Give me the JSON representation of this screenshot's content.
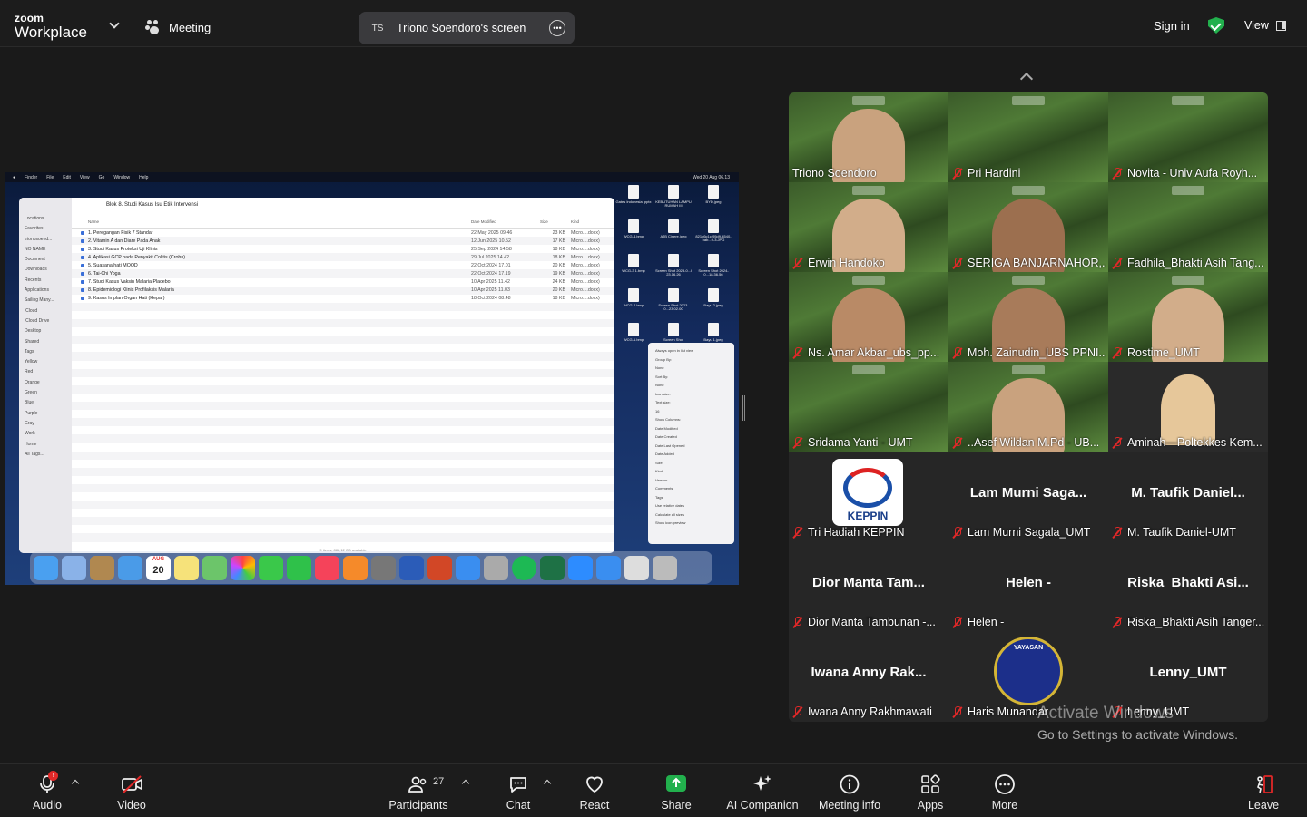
{
  "app": {
    "logo_line1": "zoom",
    "logo_line2": "Workplace",
    "meeting_label": "Meeting",
    "screen_share": {
      "initials": "TS",
      "label": "Triono Soendoro's screen"
    },
    "sign_in": "Sign in",
    "view": "View",
    "accent": "#22b04d"
  },
  "shared_screen": {
    "menubar": [
      "Finder",
      "File",
      "Edit",
      "View",
      "Go",
      "Window",
      "Help"
    ],
    "clock": "Wed 20 Aug 06.13",
    "finder_title": "Blok 8. Studi Kasus Isu Etik Intervensi",
    "sidebar": [
      "Locations",
      "Favorites",
      "trionosoend...",
      "NO NAME",
      "Document",
      "Downloads",
      "Recents",
      "Applications",
      "Sailing Many...",
      "iCloud",
      "iCloud Drive",
      "Desktop",
      "Shared",
      "Tags",
      "Yellow",
      "Red",
      "Orange",
      "Green",
      "Blue",
      "Purple",
      "Gray",
      "Work",
      "Home",
      "All Tags..."
    ],
    "columns": [
      "Name",
      "Date Modified",
      "Size",
      "Kind"
    ],
    "files": [
      {
        "name": "1. Peregangan Fisik 7 Standar",
        "date": "22 May 2025 09.46",
        "size": "23 KB",
        "kind": "Micro....docx)"
      },
      {
        "name": "2. Vitamin A dan Diare Pada Anak",
        "date": "12 Jun 2025 10.52",
        "size": "17 KB",
        "kind": "Micro....docx)"
      },
      {
        "name": "3. Studi Kasus Proteksi Uji Klinis",
        "date": "25 Sep 2024 14.58",
        "size": "18 KB",
        "kind": "Micro....docx)"
      },
      {
        "name": "4. Aplikasi GCP pada Penyakit Colitis (Crohn)",
        "date": "29 Jul 2025 14.42",
        "size": "18 KB",
        "kind": "Micro....docx)"
      },
      {
        "name": "5. Suasana hati MOOD",
        "date": "22 Oct 2024 17.01",
        "size": "20 KB",
        "kind": "Micro....docx)"
      },
      {
        "name": "6. Tai-Chi Yoga",
        "date": "22 Oct 2024 17.19",
        "size": "19 KB",
        "kind": "Micro....docx)"
      },
      {
        "name": "7. Studi Kasus Vaksin Malaria Placebo",
        "date": "10 Apr 2025 11.42",
        "size": "24 KB",
        "kind": "Micro....docx)"
      },
      {
        "name": "8. Epidemiologi Klinis Profilaksis Malaria",
        "date": "10 Apr 2025 11.03",
        "size": "20 KB",
        "kind": "Micro....docx)"
      },
      {
        "name": "9. Kasus Implan Organ Hati (Hepar)",
        "date": "18 Oct 2024 08.48",
        "size": "18 KB",
        "kind": "Micro....docx)"
      }
    ],
    "desktop_icons": [
      "Gates Indonesia .pptx",
      "KEBUTUHAN LAMPU RUMAH III",
      "BYD.jpeg",
      "WCG-4.bmp",
      "AJB Cinere.jpeg",
      "821d6c1c-95d9-4540-bab...9-3.JPG",
      "WCG-3 1.bmp",
      "Screen Shot 2023-0...l 23.16.26",
      "Screen Shot 2024-0...18.36.56",
      "WCG-2.bmp",
      "Screen Shot 2023-0...23.02.00",
      "Bayu 2.jpeg",
      "WCG-1.bmp",
      "Screen Shot",
      "Bayu 1.jpeg"
    ],
    "view_options": [
      "Always open in list view",
      "Group By:",
      "None",
      "Sort By:",
      "None",
      "Icon size:",
      "Text size:",
      "16",
      "Show Columns:",
      "Date Modified",
      "Date Created",
      "Date Last Opened",
      "Date Added",
      "Size",
      "Kind",
      "Version",
      "Comments",
      "Tags",
      "Use relative dates",
      "Calculate all sizes",
      "Show icon preview"
    ],
    "status_text": "9 items, 888,12 GB available",
    "dock_calendar_month": "AUG",
    "dock_calendar_day": "20"
  },
  "participants": [
    {
      "name": "Triono Soendoro",
      "muted": false,
      "type": "video"
    },
    {
      "name": "Pri Hardini",
      "muted": true,
      "type": "green"
    },
    {
      "name": "Novita - Univ Aufa Royh...",
      "muted": true,
      "type": "green"
    },
    {
      "name": "Erwin Handoko",
      "muted": true,
      "type": "video"
    },
    {
      "name": "SERIGA BANJARNAHOR,...",
      "muted": true,
      "type": "video"
    },
    {
      "name": "Fadhila_Bhakti Asih Tang...",
      "muted": true,
      "type": "green"
    },
    {
      "name": "Ns. Amar Akbar_ubs_pp...",
      "muted": true,
      "type": "video"
    },
    {
      "name": "Moh. Zainudin_UBS PPNI...",
      "muted": true,
      "type": "video"
    },
    {
      "name": "Rostime_UMT",
      "muted": true,
      "type": "video"
    },
    {
      "name": "Sridama Yanti - UMT",
      "muted": true,
      "type": "green"
    },
    {
      "name": "..Asef Wildan M.Pd - UB...",
      "muted": true,
      "type": "video"
    },
    {
      "name": "Aminah—Poltekkes Kem...",
      "muted": true,
      "type": "avatar"
    },
    {
      "name": "Tri Hadiah KEPPIN",
      "muted": true,
      "type": "logo",
      "logo_text": "KEPPIN"
    },
    {
      "name": "Lam Murni Sagala_UMT",
      "muted": true,
      "type": "text",
      "big": "Lam Murni Saga..."
    },
    {
      "name": "M. Taufik Daniel-UMT",
      "muted": true,
      "type": "text",
      "big": "M. Taufik Daniel..."
    },
    {
      "name": "Dior Manta Tambunan -...",
      "muted": true,
      "type": "text",
      "big": "Dior Manta Tam..."
    },
    {
      "name": "Helen -",
      "muted": true,
      "type": "text",
      "big": "Helen -"
    },
    {
      "name": "Riska_Bhakti Asih Tanger...",
      "muted": true,
      "type": "text",
      "big": "Riska_Bhakti Asi..."
    },
    {
      "name": "Iwana Anny Rakhmawati",
      "muted": true,
      "type": "text",
      "big": "Iwana Anny Rak..."
    },
    {
      "name": "Haris Munandar",
      "muted": true,
      "type": "yayasan",
      "logo_text": "YAYASAN"
    },
    {
      "name": "Lenny_UMT",
      "muted": true,
      "type": "text",
      "big": "Lenny_UMT"
    }
  ],
  "watermark": {
    "line1": "Activate Windows",
    "line2": "Go to Settings to activate Windows."
  },
  "toolbar": {
    "audio": "Audio",
    "audio_badge": "!",
    "video": "Video",
    "participants": "Participants",
    "participants_count": "27",
    "chat": "Chat",
    "react": "React",
    "share": "Share",
    "ai_companion": "AI Companion",
    "meeting_info": "Meeting info",
    "apps": "Apps",
    "more": "More",
    "leave": "Leave",
    "leave_color": "#e02828"
  }
}
